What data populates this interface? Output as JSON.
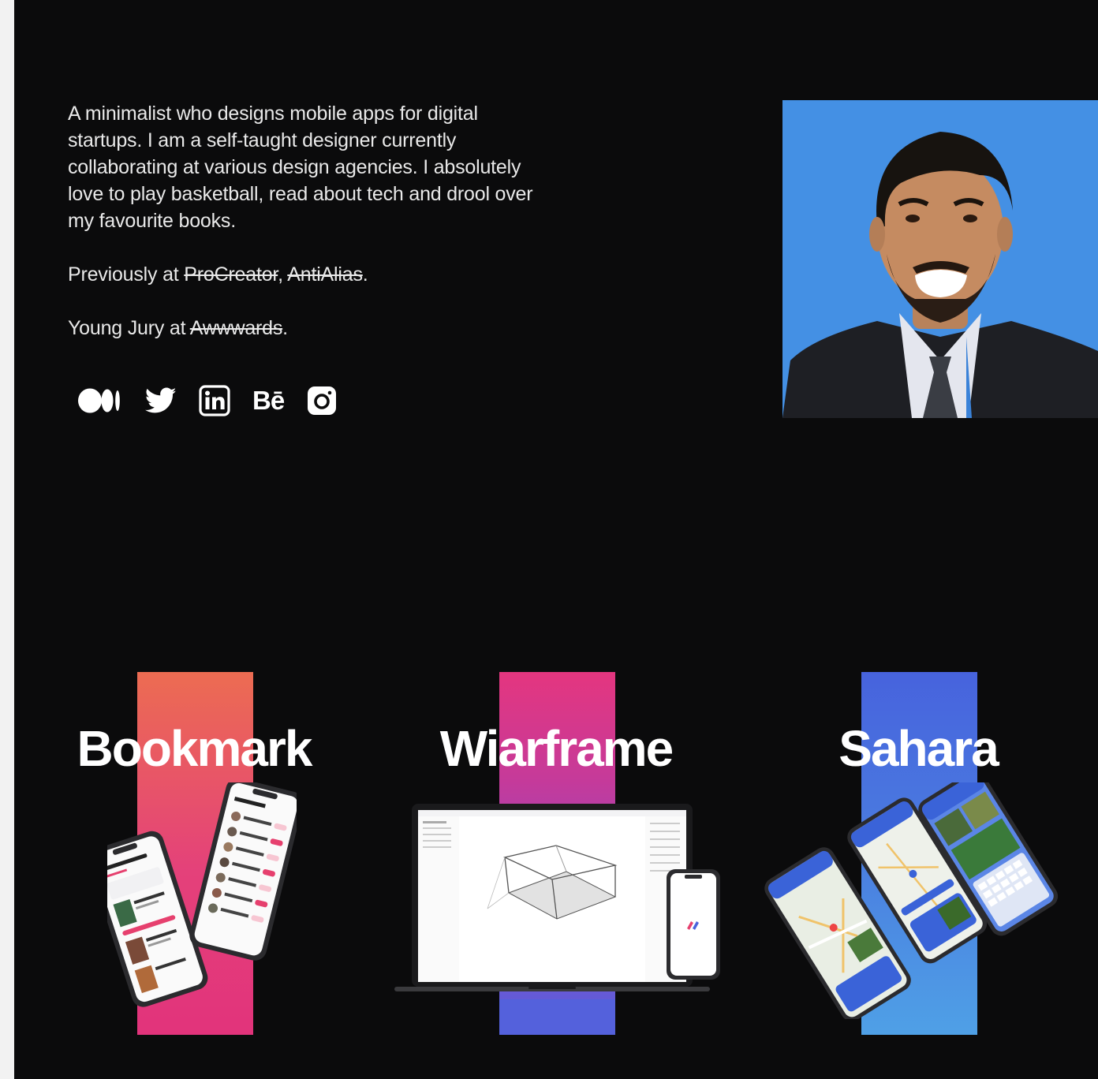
{
  "bio": {
    "intro": "A minimalist who designs mobile apps for digital startups. I am a self-taught designer currently collaborating at various design agencies. I absolutely love to play basketball, read about tech and drool over my favourite books.",
    "previously_prefix": "Previously at ",
    "previously_company_1": "ProCreator",
    "previously_separator": ", ",
    "previously_company_2": "AntiAlias",
    "previously_suffix": ".",
    "jury_prefix": "Young Jury at ",
    "jury_org": "Awwwards",
    "jury_suffix": "."
  },
  "socials": {
    "behance_label": "Bē",
    "icons": [
      "medium-icon",
      "twitter-icon",
      "linkedin-icon",
      "behance-icon",
      "instagram-icon"
    ]
  },
  "projects": [
    {
      "title": "Bookmark",
      "colors": [
        "#ec6c52",
        "#e2337b"
      ]
    },
    {
      "title": "Wiarframe",
      "colors": [
        "#e4367f",
        "#5461dc"
      ]
    },
    {
      "title": "Sahara",
      "colors": [
        "#4763dd",
        "#4fa0e6"
      ]
    }
  ],
  "colors": {
    "background": "#0b0b0c",
    "portrait_bg": "#4490e4"
  }
}
